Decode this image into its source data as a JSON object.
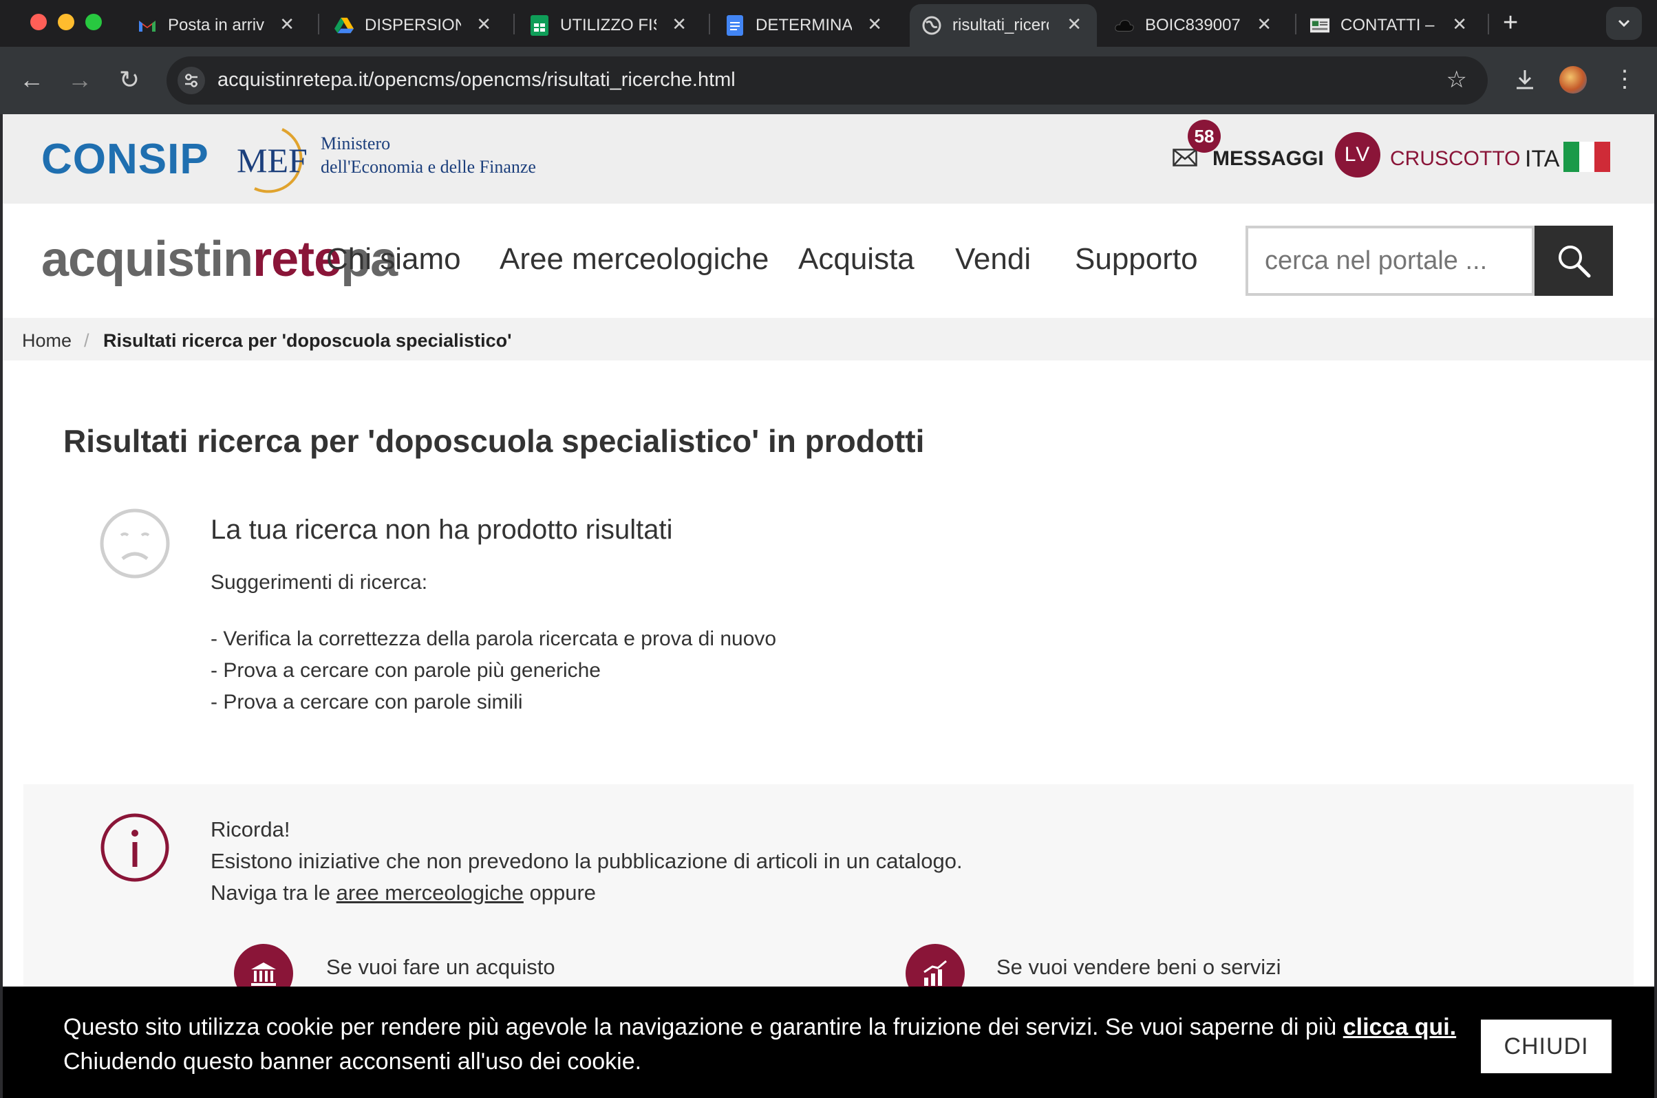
{
  "browser": {
    "tabs": [
      {
        "title": "Posta in arrivo",
        "icon": "gmail-icon"
      },
      {
        "title": "DISPERSIONE",
        "icon": "drive-icon"
      },
      {
        "title": "UTILIZZO FIS",
        "icon": "sheets-icon"
      },
      {
        "title": "DETERMINA",
        "icon": "docs-icon"
      },
      {
        "title": "risultati_ricerche",
        "icon": "globe-icon"
      },
      {
        "title": "BOIC839007",
        "icon": "cloud-icon"
      },
      {
        "title": "CONTATTI –",
        "icon": "site-icon"
      }
    ],
    "new_tab": "+",
    "url": "acquistinretepa.it/opencms/opencms/risultati_ricerche.html"
  },
  "topbar": {
    "logo_consip": "CONSIP",
    "mef_acronym": "MEF",
    "mef_line1": "Ministero",
    "mef_line2": "dell'Economia e delle Finanze",
    "messages_count": "58",
    "messages_label": "MESSAGGI",
    "avatar_initials": "LV",
    "dashboard_label": "CRUSCOTTO",
    "language": "ITA"
  },
  "nav": {
    "brand_a": "acquistin",
    "brand_b": "rete",
    "brand_c": "pa",
    "items": [
      "Chi siamo",
      "Aree merceologiche",
      "Acquista",
      "Vendi",
      "Supporto"
    ],
    "search_placeholder": "cerca nel portale ..."
  },
  "breadcrumb": {
    "home": "Home",
    "separator": "/",
    "current": "Risultati ricerca per 'doposcuola specialistico'"
  },
  "results": {
    "title": "Risultati ricerca per 'doposcuola specialistico' in prodotti",
    "no_results": "La tua ricerca non ha prodotto risultati",
    "suggestions_label": "Suggerimenti di ricerca:",
    "suggestions": [
      "- Verifica la correttezza della parola ricercata e prova di nuovo",
      "- Prova a cercare con parole più generiche",
      "- Prova a cercare con parole simili"
    ]
  },
  "remind": {
    "title": "Ricorda!",
    "line1": "Esistono iniziative che non prevedono la pubblicazione di articoli in un catalogo.",
    "line2_prefix": "Naviga tra le ",
    "line2_link": "aree merceologiche",
    "line2_suffix": " oppure",
    "buy": "Se vuoi fare un acquisto",
    "sell": "Se vuoi vendere beni o servizi"
  },
  "cookie": {
    "line1": "Questo sito utilizza cookie per rendere più agevole la navigazione e garantire la fruizione dei servizi. Se vuoi saperne di più ",
    "link": "clicca qui.",
    "line2": "Chiudendo questo banner acconsenti all'uso dei cookie.",
    "close": "CHIUDI"
  },
  "colors": {
    "accent": "#8a1538",
    "consip_blue": "#1f6fb0",
    "chrome_dark": "#1f1f21"
  }
}
